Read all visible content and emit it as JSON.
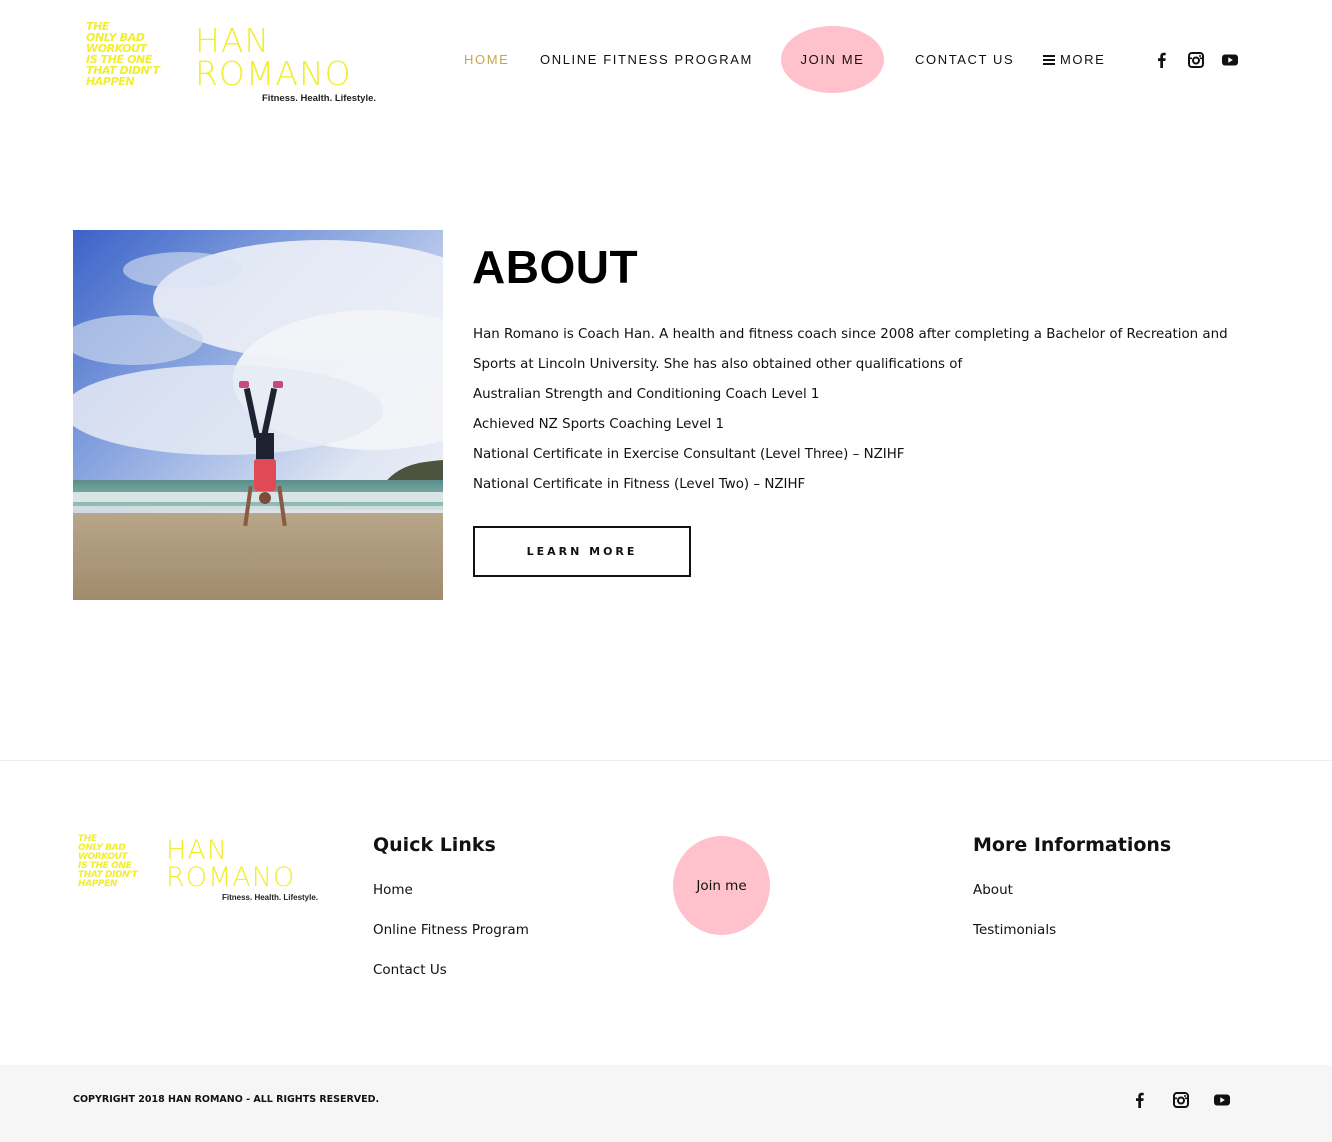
{
  "brand": {
    "mark_lines": [
      "THE",
      "ONLY BAD",
      "WORKOUT",
      "IS THE ONE",
      "THAT DIDN'T",
      "HAPPEN"
    ],
    "name_lines": [
      "HAN",
      "ROMANO"
    ],
    "tagline": "Fitness. Health. Lifestyle.",
    "accent_color": "#f1ee2f",
    "pink_color": "#ffc1cb",
    "active_nav_color": "#c9a54a"
  },
  "nav": {
    "home": "HOME",
    "online_fitness_program": "ONLINE FITNESS PROGRAM",
    "join_me": "JOIN ME",
    "contact_us": "CONTACT US",
    "more": "MORE"
  },
  "social_icons": [
    "facebook-icon",
    "instagram-icon",
    "youtube-icon"
  ],
  "about": {
    "title": "ABOUT",
    "paragraphs": [
      "Han Romano is Coach Han. A health and fitness coach since 2008 after completing a Bachelor of  Recreation and Sports at Lincoln University. She has also obtained other qualifications of",
      "Australian Strength and Conditioning Coach Level 1",
      "Achieved NZ Sports Coaching Level 1",
      "National Certificate in Exercise Consultant (Level Three) – NZIHF",
      "National Certificate in Fitness (Level Two) – NZIHF"
    ],
    "button_label": "LEARN MORE"
  },
  "footer": {
    "quick_links_heading": "Quick Links",
    "quick_links": [
      "Home",
      "Online Fitness Program",
      "Contact Us"
    ],
    "join_label": "Join me",
    "more_info_heading": "More Informations",
    "more_info_links": [
      "About",
      "Testimonials"
    ],
    "copyright": "COPYRIGHT 2018 HAN ROMANO - ALL RIGHTS RESERVED."
  }
}
